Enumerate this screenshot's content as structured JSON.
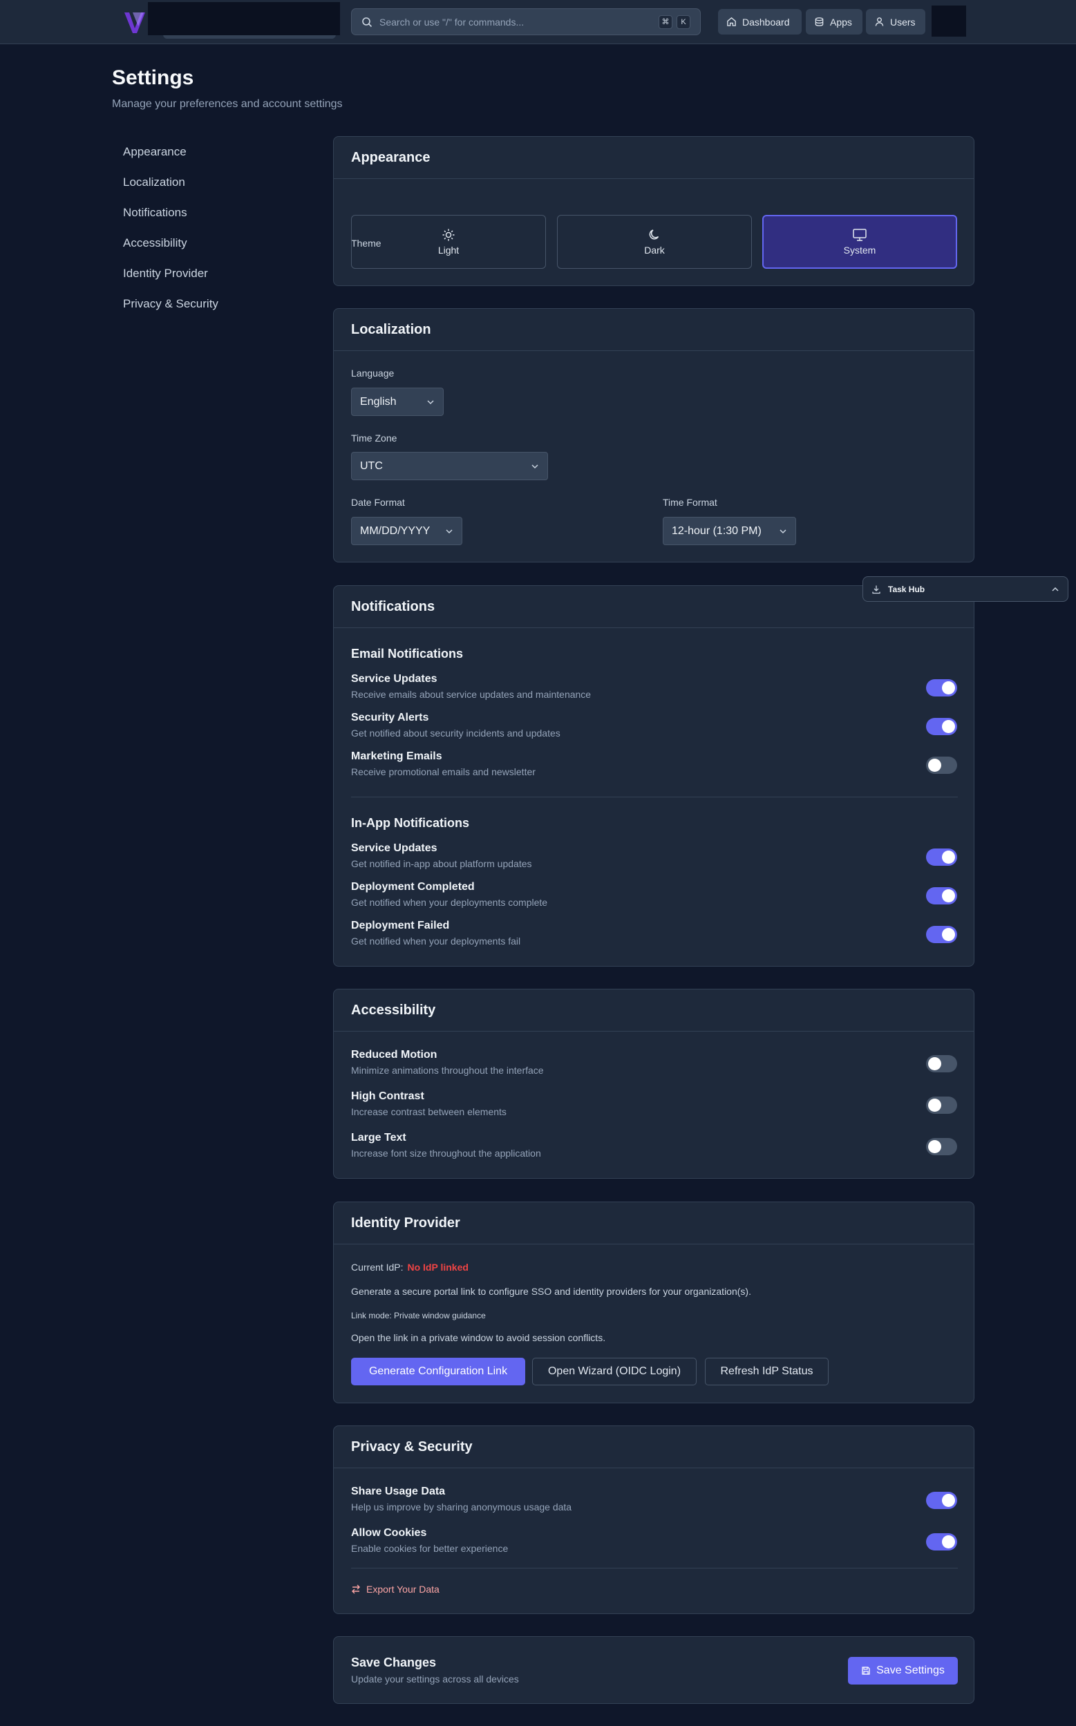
{
  "topbar": {
    "search_placeholder": "Search or use \"/\" for commands...",
    "shortcut_keys": [
      "⌘",
      "K"
    ],
    "nav": [
      {
        "label": "Dashboard",
        "icon": "home-icon"
      },
      {
        "label": "Apps",
        "icon": "database-icon"
      },
      {
        "label": "Users",
        "icon": "user-icon"
      }
    ]
  },
  "page": {
    "title": "Settings",
    "subtitle": "Manage your preferences and account settings"
  },
  "sidenav": [
    "Appearance",
    "Localization",
    "Notifications",
    "Accessibility",
    "Identity Provider",
    "Privacy & Security"
  ],
  "appearance": {
    "title": "Appearance",
    "theme_label": "Theme",
    "themes": [
      {
        "label": "Light",
        "icon": "sun-icon"
      },
      {
        "label": "Dark",
        "icon": "moon-icon"
      },
      {
        "label": "System",
        "icon": "monitor-icon",
        "selected": true
      }
    ]
  },
  "localization": {
    "title": "Localization",
    "language_label": "Language",
    "language_value": "English",
    "timezone_label": "Time Zone",
    "timezone_value": "UTC",
    "date_format_label": "Date Format",
    "date_format_value": "MM/DD/YYYY",
    "time_format_label": "Time Format",
    "time_format_value": "12-hour (1:30 PM)"
  },
  "notifications": {
    "title": "Notifications",
    "email_heading": "Email Notifications",
    "email": [
      {
        "title": "Service Updates",
        "desc": "Receive emails about service updates and maintenance",
        "on": true
      },
      {
        "title": "Security Alerts",
        "desc": "Get notified about security incidents and updates",
        "on": true
      },
      {
        "title": "Marketing Emails",
        "desc": "Receive promotional emails and newsletter",
        "on": false
      }
    ],
    "inapp_heading": "In-App Notifications",
    "inapp": [
      {
        "title": "Service Updates",
        "desc": "Get notified in-app about platform updates",
        "on": true
      },
      {
        "title": "Deployment Completed",
        "desc": "Get notified when your deployments complete",
        "on": true
      },
      {
        "title": "Deployment Failed",
        "desc": "Get notified when your deployments fail",
        "on": true
      }
    ]
  },
  "accessibility": {
    "title": "Accessibility",
    "items": [
      {
        "title": "Reduced Motion",
        "desc": "Minimize animations throughout the interface",
        "on": false
      },
      {
        "title": "High Contrast",
        "desc": "Increase contrast between elements",
        "on": false
      },
      {
        "title": "Large Text",
        "desc": "Increase font size throughout the application",
        "on": false
      }
    ]
  },
  "idp": {
    "title": "Identity Provider",
    "current_label": "Current IdP:",
    "current_value": "No IdP linked",
    "description": "Generate a secure portal link to configure SSO and identity providers for your organization(s).",
    "link_mode": "Link mode: Private window guidance",
    "hint": "Open the link in a private window to avoid session conflicts.",
    "btn_generate": "Generate Configuration Link",
    "btn_wizard": "Open Wizard (OIDC Login)",
    "btn_refresh": "Refresh IdP Status"
  },
  "privacy": {
    "title": "Privacy & Security",
    "items": [
      {
        "title": "Share Usage Data",
        "desc": "Help us improve by sharing anonymous usage data",
        "on": true
      },
      {
        "title": "Allow Cookies",
        "desc": "Enable cookies for better experience",
        "on": true
      }
    ],
    "export_label": "Export Your Data"
  },
  "save": {
    "title": "Save Changes",
    "desc": "Update your settings across all devices",
    "button": "Save Settings"
  },
  "taskhub": {
    "label": "Task Hub"
  },
  "colors": {
    "accent": "#6366f1",
    "bg": "#0f172a",
    "card": "#1e293b",
    "danger": "#ef4444"
  }
}
